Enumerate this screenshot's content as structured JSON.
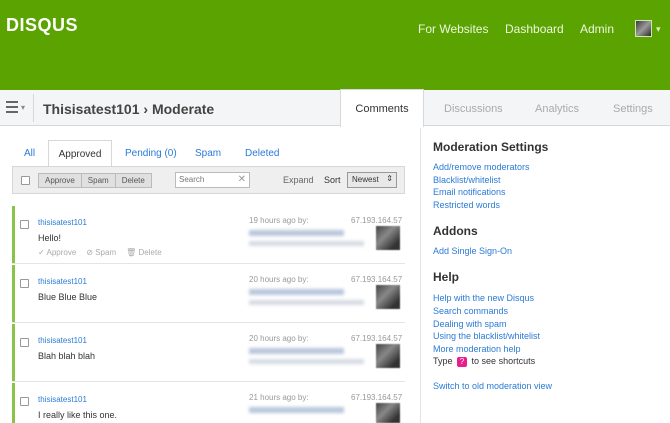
{
  "header": {
    "logo": "DISQUS",
    "nav": [
      "For Websites",
      "Dashboard",
      "Admin"
    ]
  },
  "subheader": {
    "breadcrumb": "Thisisatest101 › Moderate",
    "tabs": [
      "Comments",
      "Discussions",
      "Analytics",
      "Settings"
    ],
    "active_tab": "Comments"
  },
  "filters": {
    "tabs": [
      "All",
      "Approved",
      "Pending (0)",
      "Spam",
      "Deleted"
    ],
    "active": "Approved"
  },
  "toolbar": {
    "approve": "Approve",
    "spam": "Spam",
    "delete": "Delete",
    "search_placeholder": "Search",
    "expand": "Expand",
    "sort_label": "Sort",
    "sort_value": "Newest"
  },
  "comments": [
    {
      "author": "thisisatest101",
      "message": "Hello!",
      "time": "19 hours ago by:",
      "ip": "67.193.164.57",
      "actions": [
        "Approve",
        "Spam",
        "Delete"
      ]
    },
    {
      "author": "thisisatest101",
      "message": "Blue Blue Blue",
      "time": "20 hours ago by:",
      "ip": "67.193.164.57"
    },
    {
      "author": "thisisatest101",
      "message": "Blah blah blah",
      "time": "20 hours ago by:",
      "ip": "67.193.164.57"
    },
    {
      "author": "thisisatest101",
      "message": "I really like this one.",
      "time": "21 hours ago by:",
      "ip": "67.193.164.57"
    }
  ],
  "sidebar": {
    "moderation_title": "Moderation Settings",
    "moderation_links": [
      "Add/remove moderators",
      "Blacklist/whitelist",
      "Email notifications",
      "Restricted words"
    ],
    "addons_title": "Addons",
    "addons_links": [
      "Add Single Sign-On"
    ],
    "help_title": "Help",
    "help_links": [
      "Help with the new Disqus",
      "Search commands",
      "Dealing with spam",
      "Using the blacklist/whitelist",
      "More moderation help"
    ],
    "type_prefix": "Type",
    "type_key": "?",
    "type_suffix": "to see shortcuts",
    "switch_link": "Switch to old moderation view"
  },
  "colors": {
    "brand": "#5aa300",
    "link": "#2a7bd6",
    "accent": "#8bc34a"
  }
}
